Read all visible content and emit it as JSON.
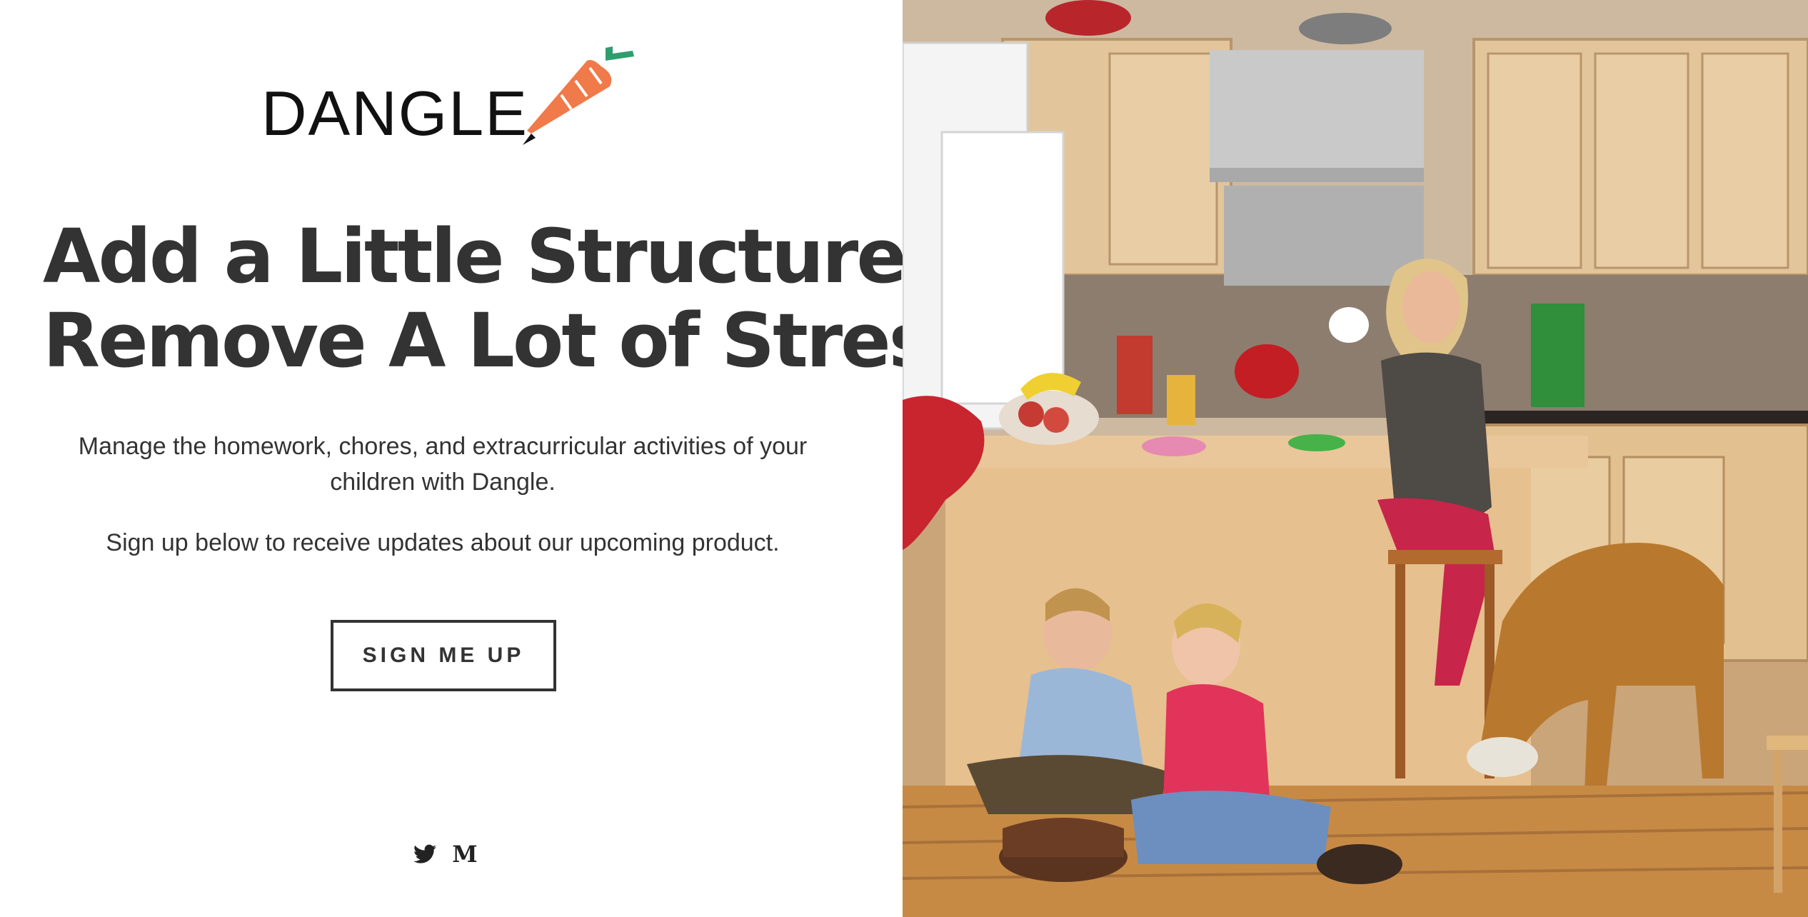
{
  "brand": {
    "name": "DANGLE",
    "logo_icon": "carrot-icon",
    "colors": {
      "carrot": "#f07a4a",
      "carrot_dark": "#d9643a",
      "leaf": "#2e9e6e"
    }
  },
  "hero": {
    "headline_line1": "Add a Little Structure,",
    "headline_line2": "Remove A Lot of Stress",
    "description": "Manage the homework, chores, and extracurricular activities of your children with Dangle.",
    "signup_prompt": "Sign up below to receive updates about our upcoming product."
  },
  "cta": {
    "label": "SIGN ME UP"
  },
  "social": {
    "twitter_icon": "twitter-icon",
    "medium_icon": "medium-icon",
    "medium_glyph": "M"
  },
  "photo": {
    "subject": "kitchen-scene-photo"
  }
}
